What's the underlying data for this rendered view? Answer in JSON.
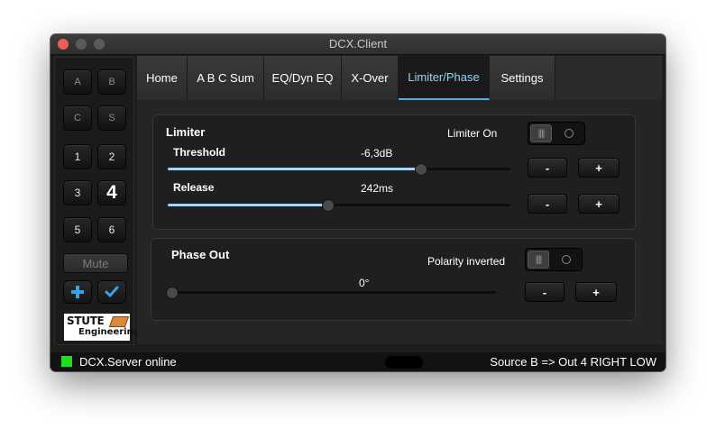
{
  "window": {
    "title": "DCX.Client"
  },
  "sidebar": {
    "buttons": [
      {
        "label": "A"
      },
      {
        "label": "B"
      },
      {
        "label": "C"
      },
      {
        "label": "S"
      },
      {
        "label": "1"
      },
      {
        "label": "2"
      },
      {
        "label": "3"
      },
      {
        "label": "4",
        "selected": true
      },
      {
        "label": "5"
      },
      {
        "label": "6"
      }
    ],
    "mute_label": "Mute",
    "add_icon": "plus-icon",
    "confirm_icon": "checkmark-icon",
    "logo": {
      "line1": "STUTE",
      "line2": "Engineering"
    }
  },
  "tabs": [
    {
      "label": "Home"
    },
    {
      "label": "A B C Sum"
    },
    {
      "label": "EQ/Dyn EQ"
    },
    {
      "label": "X-Over"
    },
    {
      "label": "Limiter/Phase",
      "active": true
    },
    {
      "label": "Settings"
    }
  ],
  "limiter": {
    "title": "Limiter",
    "toggle_label": "Limiter On",
    "toggle_on": false,
    "threshold": {
      "label": "Threshold",
      "value_text": "-6,3dB",
      "fraction": 0.736
    },
    "release": {
      "label": "Release",
      "value_text": "242ms",
      "fraction": 0.465
    },
    "minus_label": "-",
    "plus_label": "+"
  },
  "phase": {
    "title": "Phase Out",
    "toggle_label": "Polarity inverted",
    "toggle_on": false,
    "value_text": "0°",
    "fraction": 0.0,
    "minus_label": "-",
    "plus_label": "+"
  },
  "status": {
    "left": "DCX.Server online",
    "right": "Source B => Out 4 RIGHT LOW",
    "led_color": "#1fe01f"
  },
  "colors": {
    "accent": "#8fd6ff",
    "slider_fill": "#a9d4f1",
    "close": "#ec5e58"
  }
}
